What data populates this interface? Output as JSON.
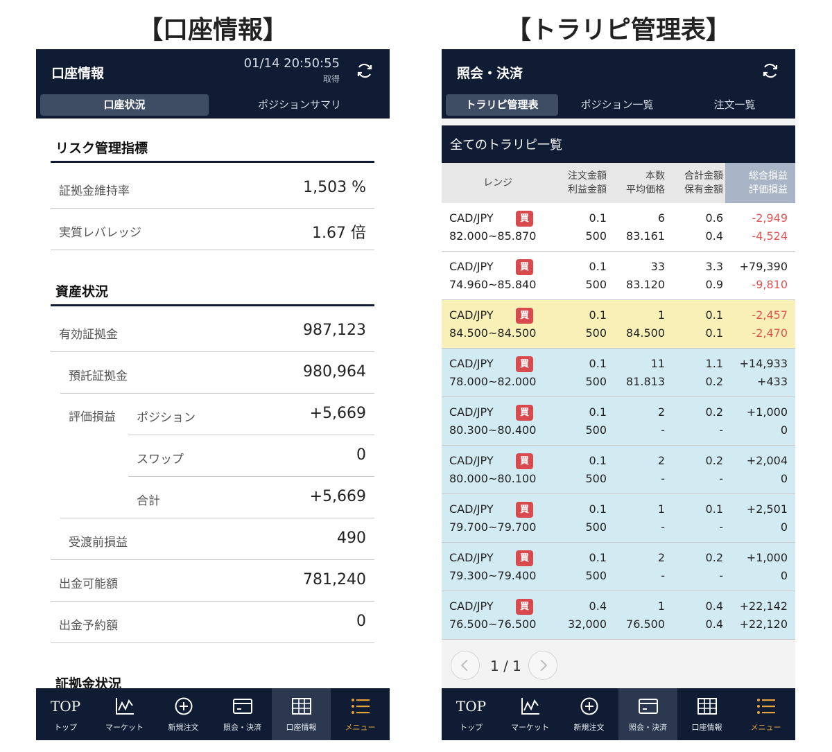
{
  "captions": {
    "left": "【口座情報】",
    "right": "【トラリピ管理表】"
  },
  "left": {
    "title": "口座情報",
    "datetime": "01/14 20:50:55",
    "acquire": "取得",
    "tabs": [
      "口座状況",
      "ポジションサマリ"
    ],
    "risk_title": "リスク管理指標",
    "risk": [
      {
        "label": "証拠金維持率",
        "value": "1,503 %"
      },
      {
        "label": "実質レバレッジ",
        "value": "1.67 倍"
      }
    ],
    "asset_title": "資産状況",
    "assets": {
      "effective_label": "有効証拠金",
      "effective_value": "987,123",
      "deposit_label": "預託証拠金",
      "deposit_value": "980,964",
      "eval_label": "評価損益",
      "position_label": "ポジション",
      "position_value": "+5,669",
      "swap_label": "スワップ",
      "swap_value": "0",
      "total_label": "合計",
      "total_value": "+5,669",
      "pre_label": "受渡前損益",
      "pre_value": "490",
      "withdrawable_label": "出金可能額",
      "withdrawable_value": "781,240",
      "reserved_label": "出金予約額",
      "reserved_value": "0"
    },
    "margin_title": "証拠金状況"
  },
  "right": {
    "title": "照会・決済",
    "tabs": [
      "トラリピ管理表",
      "ポジション一覧",
      "注文一覧"
    ],
    "list_title": "全てのトラリピ一覧",
    "headers": {
      "range": "レンジ",
      "c1a": "注文金額",
      "c1b": "利益金額",
      "c2a": "本数",
      "c2b": "平均価格",
      "c3a": "合計金額",
      "c3b": "保有金額",
      "c4a": "総合損益",
      "c4b": "評価損益"
    },
    "buy_label": "買",
    "rows": [
      {
        "pair": "CAD/JPY",
        "range": "82.000~85.870",
        "order": "0.1",
        "profit": "500",
        "count": "6",
        "avg": "83.161",
        "total": "0.6",
        "held": "0.4",
        "pl_total": "-2,949",
        "pl_eval": "-4,524"
      },
      {
        "pair": "CAD/JPY",
        "range": "74.960~85.840",
        "order": "0.1",
        "profit": "500",
        "count": "33",
        "avg": "83.120",
        "total": "3.3",
        "held": "0.9",
        "pl_total": "+79,390",
        "pl_eval": "-9,810"
      },
      {
        "pair": "CAD/JPY",
        "range": "84.500~84.500",
        "order": "0.1",
        "profit": "500",
        "count": "1",
        "avg": "84.500",
        "total": "0.1",
        "held": "0.1",
        "pl_total": "-2,457",
        "pl_eval": "-2,470"
      },
      {
        "pair": "CAD/JPY",
        "range": "78.000~82.000",
        "order": "0.1",
        "profit": "500",
        "count": "11",
        "avg": "81.813",
        "total": "1.1",
        "held": "0.2",
        "pl_total": "+14,933",
        "pl_eval": "+433"
      },
      {
        "pair": "CAD/JPY",
        "range": "80.300~80.400",
        "order": "0.1",
        "profit": "500",
        "count": "2",
        "avg": "-",
        "total": "0.2",
        "held": "-",
        "pl_total": "+1,000",
        "pl_eval": "0"
      },
      {
        "pair": "CAD/JPY",
        "range": "80.000~80.100",
        "order": "0.1",
        "profit": "500",
        "count": "2",
        "avg": "-",
        "total": "0.2",
        "held": "-",
        "pl_total": "+2,004",
        "pl_eval": "0"
      },
      {
        "pair": "CAD/JPY",
        "range": "79.700~79.700",
        "order": "0.1",
        "profit": "500",
        "count": "1",
        "avg": "-",
        "total": "0.1",
        "held": "-",
        "pl_total": "+2,501",
        "pl_eval": "0"
      },
      {
        "pair": "CAD/JPY",
        "range": "79.300~79.400",
        "order": "0.1",
        "profit": "500",
        "count": "2",
        "avg": "-",
        "total": "0.2",
        "held": "-",
        "pl_total": "+1,000",
        "pl_eval": "0"
      },
      {
        "pair": "CAD/JPY",
        "range": "76.500~76.500",
        "order": "0.4",
        "profit": "32,000",
        "count": "1",
        "avg": "76.500",
        "total": "0.4",
        "held": "0.4",
        "pl_total": "+22,142",
        "pl_eval": "+22,120"
      }
    ],
    "row_colors": [
      "#ffffff",
      "#ffffff",
      "#f8f0b7",
      "#d2ebf2",
      "#d2ebf2",
      "#d2ebf2",
      "#d2ebf2",
      "#d2ebf2",
      "#d2ebf2"
    ],
    "page_text": "1 / 1"
  },
  "nav": {
    "top_glyph": "TOP",
    "items": [
      "トップ",
      "マーケット",
      "新規注文",
      "照会・決済",
      "口座情報",
      "メニュー"
    ]
  },
  "colors": {
    "navy": "#0f1c33",
    "negative": "#e15353",
    "buy_badge": "#d94a4f",
    "menu_accent": "#e4a23b"
  }
}
